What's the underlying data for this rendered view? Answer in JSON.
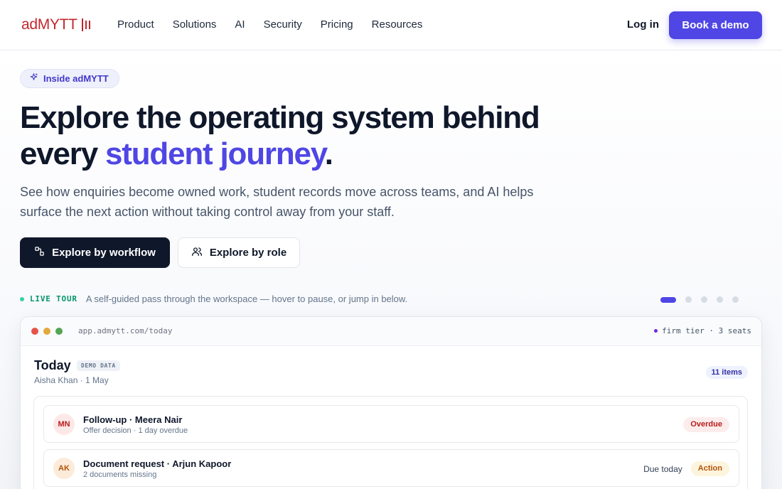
{
  "brand": {
    "name": "adMYTT",
    "color": "#c2272d"
  },
  "nav": {
    "items": [
      "Product",
      "Solutions",
      "AI",
      "Security",
      "Pricing",
      "Resources"
    ],
    "login": "Log in",
    "cta": "Book a demo"
  },
  "hero": {
    "pill": "Inside adMYTT",
    "headline_line1": "Explore the operating system behind",
    "headline_line2_prefix": "every ",
    "headline_accent": "student journey",
    "headline_suffix": ".",
    "subtitle": "See how enquiries become owned work, student records move across teams, and AI helps surface the next action without taking control away from your staff.",
    "primary_cta": "Explore by workflow",
    "secondary_cta": "Explore by role"
  },
  "tour": {
    "label": "LIVE TOUR",
    "description": "A self-guided pass through the workspace — hover to pause, or jump in below.",
    "slides": 5,
    "active_slide": 1
  },
  "browser": {
    "url": "app.admytt.com/today",
    "tier": "firm tier · 3 seats"
  },
  "today": {
    "title": "Today",
    "tag": "DEMO DATA",
    "subtitle": "Aisha Khan · 1 May",
    "count": "11 items",
    "tasks": [
      {
        "initials": "MN",
        "title": "Follow-up · Meera Nair",
        "subtitle": "Offer decision · 1 day overdue",
        "due": "",
        "status": "Overdue"
      },
      {
        "initials": "AK",
        "title": "Document request · Arjun Kapoor",
        "subtitle": "2 documents missing",
        "due": "Due today",
        "status": "Action"
      }
    ]
  },
  "colors": {
    "accent": "#4f46e5",
    "dark": "#0f172a",
    "live": "#059669",
    "overdue_bg": "#fdecec",
    "overdue_text": "#b91c1c",
    "action_bg": "#fdf4dd",
    "action_text": "#b45309"
  },
  "icons": {
    "pill": "sparkle-icon",
    "primary_cta": "workflow-icon",
    "secondary_cta": "users-icon"
  }
}
